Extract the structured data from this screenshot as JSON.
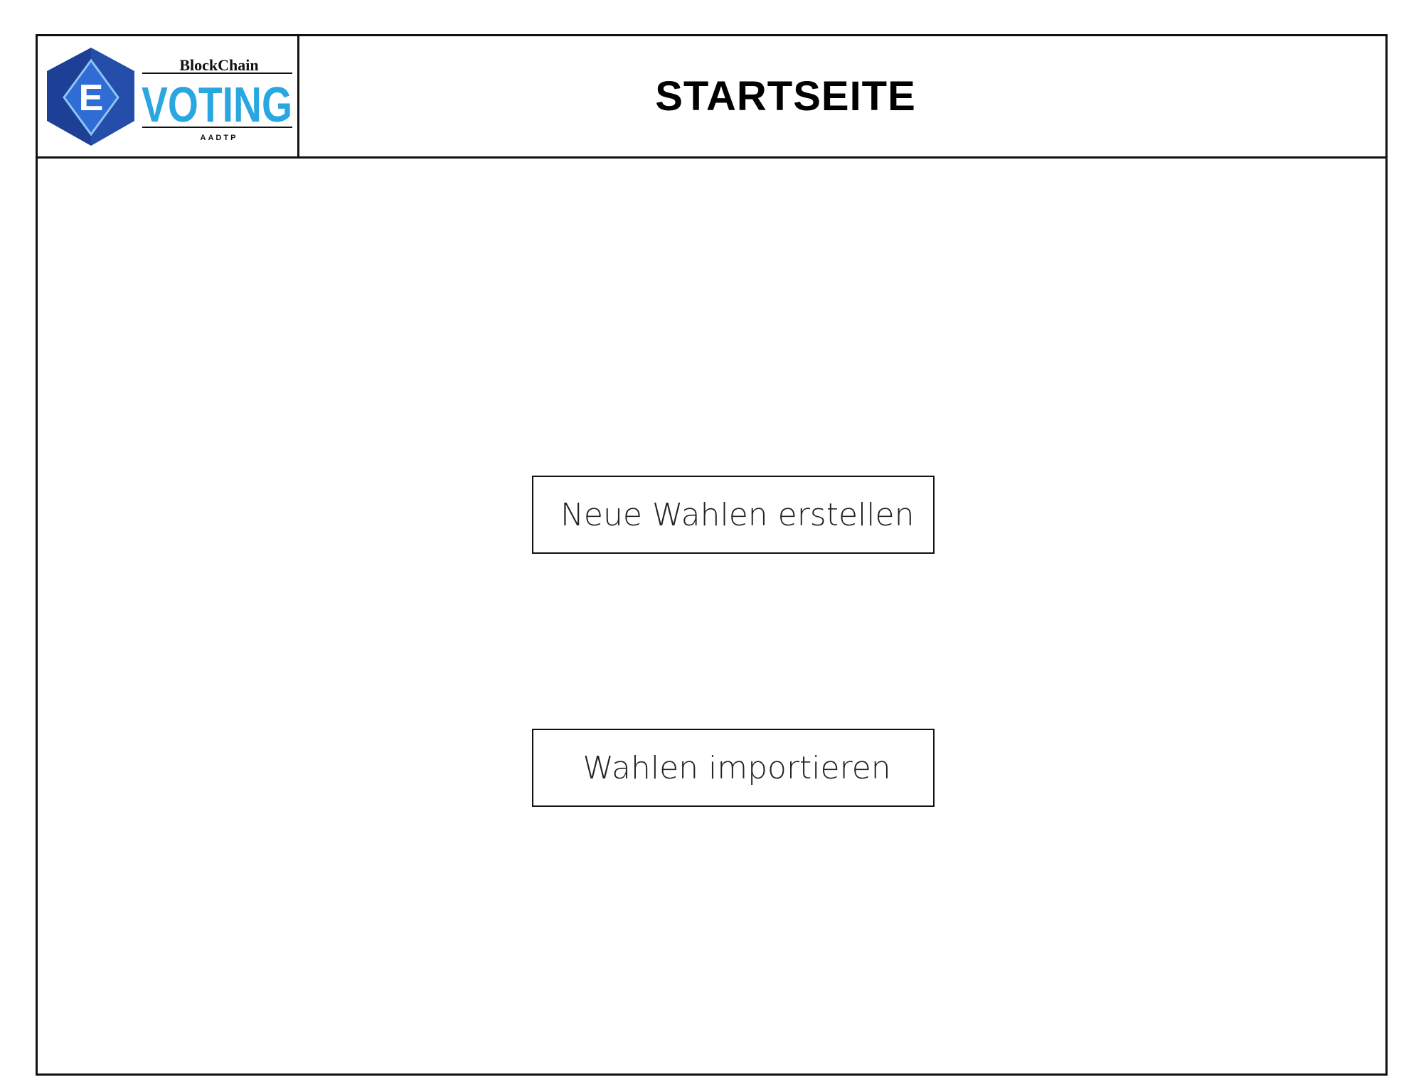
{
  "header": {
    "title": "STARTSEITE",
    "logo": {
      "emblem_letter": "E",
      "top_text": "BlockChain",
      "main_text": "VOTING",
      "bottom_text": "AADTP",
      "colors": {
        "hexagon_dark": "#1d3f95",
        "hexagon_light": "#2f6cd3",
        "diamond": "#1f4fb5",
        "text_blue": "#2aa7e0",
        "text_dark": "#111111"
      }
    }
  },
  "actions": {
    "create_label": "Neue Wahlen erstellen",
    "import_label": "Wahlen importieren"
  }
}
